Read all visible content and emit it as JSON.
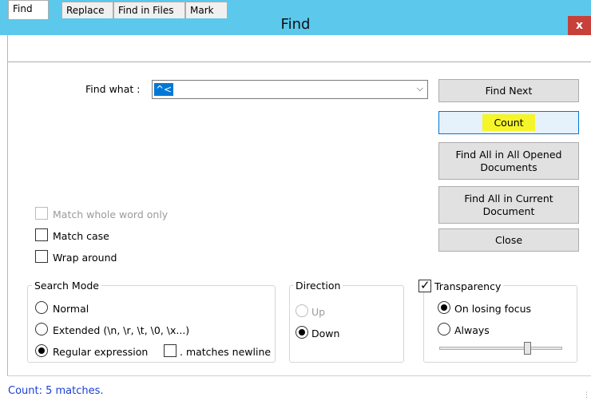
{
  "window": {
    "title": "Find",
    "close_label": "x"
  },
  "tabs": [
    {
      "label": "Find",
      "active": true
    },
    {
      "label": "Replace",
      "active": false
    },
    {
      "label": "Find in Files",
      "active": false
    },
    {
      "label": "Mark",
      "active": false
    }
  ],
  "find_what": {
    "label": "Find what :",
    "value": "^<"
  },
  "buttons": {
    "find_next": "Find Next",
    "count": "Count",
    "find_all_opened": "Find All in All Opened Documents",
    "find_all_current": "Find All in Current Document",
    "close": "Close"
  },
  "options": {
    "match_whole_word": {
      "label": "Match whole word only",
      "checked": false,
      "enabled": false
    },
    "match_case": {
      "label": "Match case",
      "checked": false
    },
    "wrap_around": {
      "label": "Wrap around",
      "checked": false
    }
  },
  "search_mode": {
    "label": "Search Mode",
    "normal": "Normal",
    "extended": "Extended (\\n, \\r, \\t, \\0, \\x...)",
    "regex": "Regular expression",
    "matches_newline": ". matches newline",
    "selected": "regex"
  },
  "direction": {
    "label": "Direction",
    "up": "Up",
    "down": "Down",
    "selected": "down"
  },
  "transparency": {
    "label": "Transparency",
    "checked": true,
    "on_losing_focus": "On losing focus",
    "always": "Always",
    "selected": "on_losing_focus",
    "level": 0.73
  },
  "status": {
    "text": "Count: 5 matches."
  },
  "colors": {
    "titlebar": "#5bc8ec",
    "close": "#c7403a",
    "highlight": "#f5f52a",
    "status_text": "#1a3fd6",
    "selection": "#0078d7"
  }
}
